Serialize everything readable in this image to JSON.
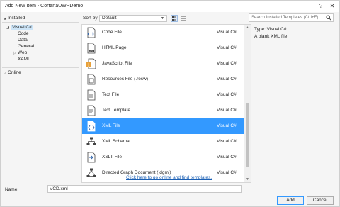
{
  "window": {
    "title": "Add New Item - CortanaUWPDemo"
  },
  "tree": {
    "installed": "Installed",
    "visual_csharp": "Visual C#",
    "children": [
      "Code",
      "Data",
      "General",
      "Web",
      "XAML"
    ],
    "online": "Online"
  },
  "toolbar": {
    "sort_label": "Sort by:",
    "sort_value": "Default",
    "search_placeholder": "Search Installed Templates (Ctrl+E)"
  },
  "items": [
    {
      "name": "Code File",
      "lang": "Visual C#",
      "icon": "code-file-icon"
    },
    {
      "name": "HTML Page",
      "lang": "Visual C#",
      "icon": "html-page-icon"
    },
    {
      "name": "JavaScript File",
      "lang": "Visual C#",
      "icon": "javascript-file-icon"
    },
    {
      "name": "Resources File (.resw)",
      "lang": "Visual C#",
      "icon": "resources-file-icon"
    },
    {
      "name": "Text File",
      "lang": "Visual C#",
      "icon": "text-file-icon"
    },
    {
      "name": "Text Template",
      "lang": "Visual C#",
      "icon": "text-template-icon"
    },
    {
      "name": "XML File",
      "lang": "Visual C#",
      "icon": "xml-file-icon",
      "selected": true
    },
    {
      "name": "XML Schema",
      "lang": "Visual C#",
      "icon": "xml-schema-icon"
    },
    {
      "name": "XSLT File",
      "lang": "Visual C#",
      "icon": "xslt-file-icon"
    },
    {
      "name": "Directed Graph Document (.dgml)",
      "lang": "Visual C#",
      "icon": "dgml-icon"
    }
  ],
  "online_link": "Click here to go online and find templates.",
  "details": {
    "type_label": "Type:",
    "type_value": "Visual C#",
    "description": "A blank XML file"
  },
  "name_field": {
    "label": "Name:",
    "value": "VCD.xml"
  },
  "buttons": {
    "add": "Add",
    "cancel": "Cancel"
  },
  "colors": {
    "selection": "#3399ff",
    "tree_selection": "#cce4f7",
    "link": "#1a5fb4"
  }
}
